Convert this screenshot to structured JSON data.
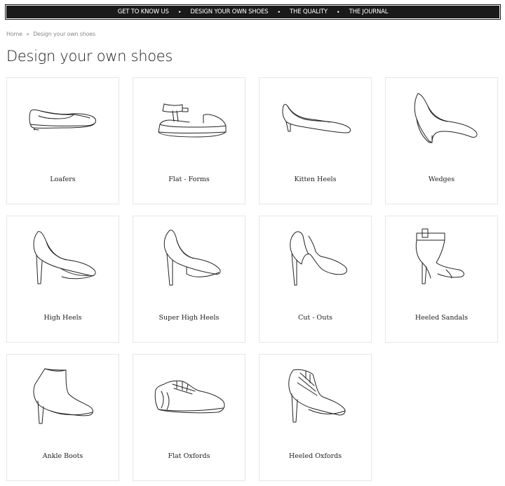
{
  "nav": {
    "items": [
      "GET TO KNOW US",
      "DESIGN YOUR OWN SHOES",
      "THE QUALITY",
      "THE JOURNAL"
    ],
    "separator": "•"
  },
  "breadcrumb": {
    "home": "Home",
    "separator": "»",
    "current": "Design your own shoes"
  },
  "page": {
    "title": "Design your own shoes"
  },
  "products": [
    {
      "label": "Loafers",
      "icon": "loafer-icon"
    },
    {
      "label": "Flat - Forms",
      "icon": "flatform-icon"
    },
    {
      "label": "Kitten Heels",
      "icon": "kitten-heel-icon"
    },
    {
      "label": "Wedges",
      "icon": "wedge-icon"
    },
    {
      "label": "High Heels",
      "icon": "high-heel-icon"
    },
    {
      "label": "Super High Heels",
      "icon": "super-high-heel-icon"
    },
    {
      "label": "Cut - Outs",
      "icon": "cut-out-icon"
    },
    {
      "label": "Heeled Sandals",
      "icon": "heeled-sandal-icon"
    },
    {
      "label": "Ankle Boots",
      "icon": "ankle-boot-icon"
    },
    {
      "label": "Flat Oxfords",
      "icon": "flat-oxford-icon"
    },
    {
      "label": "Heeled Oxfords",
      "icon": "heeled-oxford-icon"
    }
  ]
}
